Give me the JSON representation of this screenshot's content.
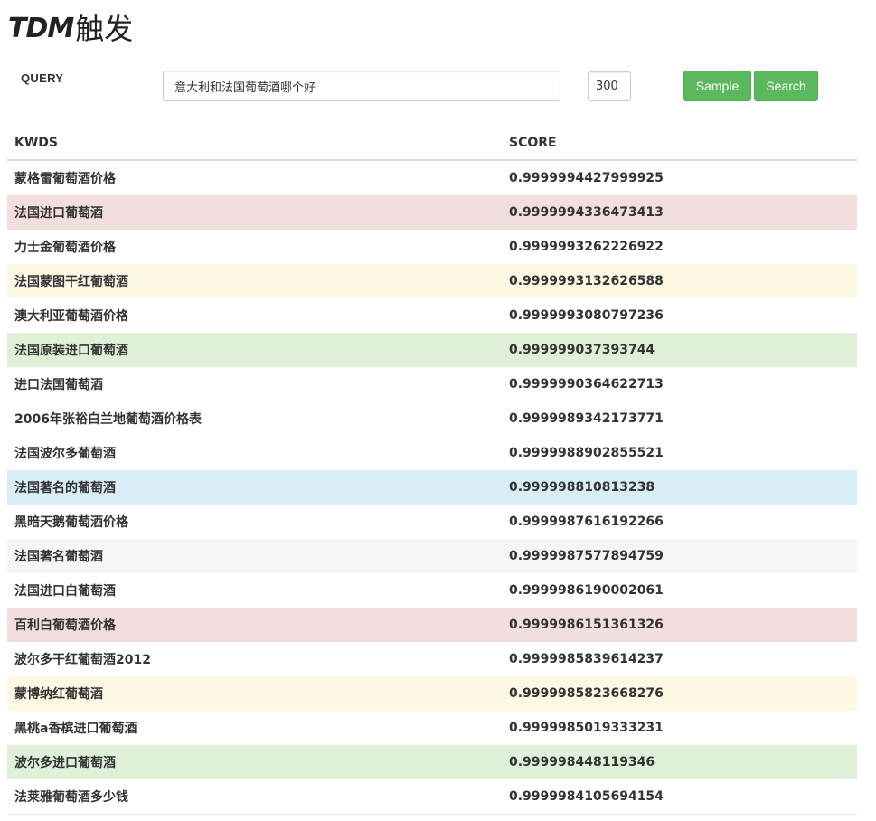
{
  "header": {
    "brand_latin": "TDM",
    "brand_cjk": "触发"
  },
  "search": {
    "label": "QUERY",
    "query_value": "意大利和法国葡萄酒哪个好",
    "count_value": "300",
    "sample_label": "Sample",
    "search_label": "Search"
  },
  "table": {
    "columns": [
      "KWDS",
      "SCORE"
    ],
    "rows": [
      {
        "kwd": "蒙格雷葡萄酒价格",
        "score": "0.9999994427999925",
        "style": "none"
      },
      {
        "kwd": "法国进口葡萄酒",
        "score": "0.9999994336473413",
        "style": "danger"
      },
      {
        "kwd": "力士金葡萄酒价格",
        "score": "0.9999993262226922",
        "style": "none"
      },
      {
        "kwd": "法国蒙图干红葡萄酒",
        "score": "0.9999993132626588",
        "style": "warning"
      },
      {
        "kwd": "澳大利亚葡萄酒价格",
        "score": "0.9999993080797236",
        "style": "none"
      },
      {
        "kwd": "法国原装进口葡萄酒",
        "score": "0.999999037393744",
        "style": "success"
      },
      {
        "kwd": "进口法国葡萄酒",
        "score": "0.9999990364622713",
        "style": "none"
      },
      {
        "kwd": "2006年张裕白兰地葡萄酒价格表",
        "score": "0.9999989342173771",
        "style": "none"
      },
      {
        "kwd": "法国波尔多葡萄酒",
        "score": "0.9999988902855521",
        "style": "none"
      },
      {
        "kwd": "法国著名的葡萄酒",
        "score": "0.999998810813238",
        "style": "info"
      },
      {
        "kwd": "黑暗天鹅葡萄酒价格",
        "score": "0.9999987616192266",
        "style": "none"
      },
      {
        "kwd": "法国著名葡萄酒",
        "score": "0.9999987577894759",
        "style": "active"
      },
      {
        "kwd": "法国进口白葡萄酒",
        "score": "0.9999986190002061",
        "style": "none"
      },
      {
        "kwd": "百利白葡萄酒价格",
        "score": "0.9999986151361326",
        "style": "danger"
      },
      {
        "kwd": "波尔多干红葡萄酒2012",
        "score": "0.9999985839614237",
        "style": "none"
      },
      {
        "kwd": "蒙博纳红葡萄酒",
        "score": "0.9999985823668276",
        "style": "warning"
      },
      {
        "kwd": "黑桃a香槟进口葡萄酒",
        "score": "0.9999985019333231",
        "style": "none"
      },
      {
        "kwd": "波尔多进口葡萄酒",
        "score": "0.999998448119346",
        "style": "success"
      },
      {
        "kwd": "法莱雅葡萄酒多少钱",
        "score": "0.9999984105694154",
        "style": "none"
      }
    ]
  },
  "colors": {
    "button_green": "#5cb85c",
    "row_danger": "#f2dede",
    "row_warning": "#fcf8e3",
    "row_success": "#dff0d8",
    "row_info": "#d9edf7",
    "row_active": "#f5f5f5"
  }
}
